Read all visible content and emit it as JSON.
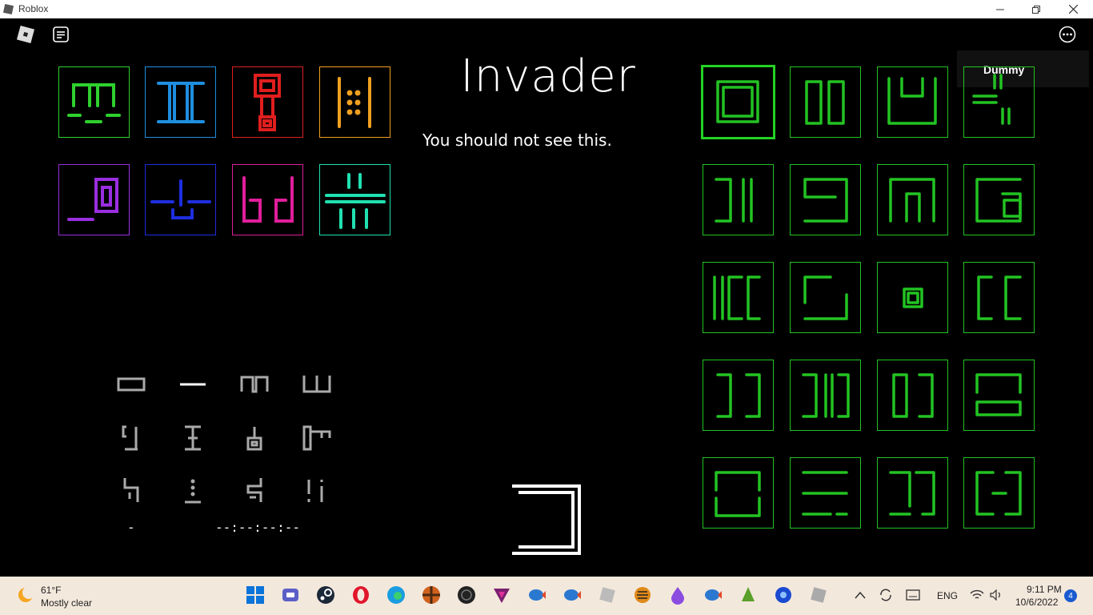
{
  "window": {
    "title": "Roblox"
  },
  "game": {
    "title": "Invader",
    "message": "You should not see this.",
    "player_name": "Dummy",
    "code_left": "-",
    "code_right": "--:--:--:--"
  },
  "palette_tiles": [
    {
      "name": "tile-green-glyph",
      "color": "#2ed02e"
    },
    {
      "name": "tile-blue-glyph",
      "color": "#1e8fe0"
    },
    {
      "name": "tile-red-glyph",
      "color": "#e01e1e"
    },
    {
      "name": "tile-orange-glyph",
      "color": "#f0a020"
    },
    {
      "name": "tile-purple-glyph",
      "color": "#9a2ee0"
    },
    {
      "name": "tile-navy-glyph",
      "color": "#1e2ee0"
    },
    {
      "name": "tile-pink-glyph",
      "color": "#e01e9a"
    },
    {
      "name": "tile-teal-glyph",
      "color": "#20e0b0"
    }
  ],
  "grid": {
    "rows": 5,
    "cols": 4,
    "selected_index": 0,
    "color": "#22c322"
  },
  "taskbar": {
    "weather_temp": "61°F",
    "weather_desc": "Mostly clear",
    "language": "ENG",
    "time": "9:11 PM",
    "date": "10/6/2022",
    "notification_count": "4"
  }
}
